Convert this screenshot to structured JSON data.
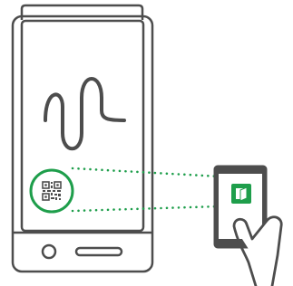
{
  "illustration": {
    "colors": {
      "outline": "#4d4d4d",
      "accent": "#1e9e4b",
      "background": "#ffffff",
      "phone_screen": "#ffffff"
    },
    "icons": [
      "tablet-device-icon",
      "signature-icon",
      "qr-code-icon",
      "smartphone-icon",
      "app-icon",
      "hand-icon"
    ]
  }
}
